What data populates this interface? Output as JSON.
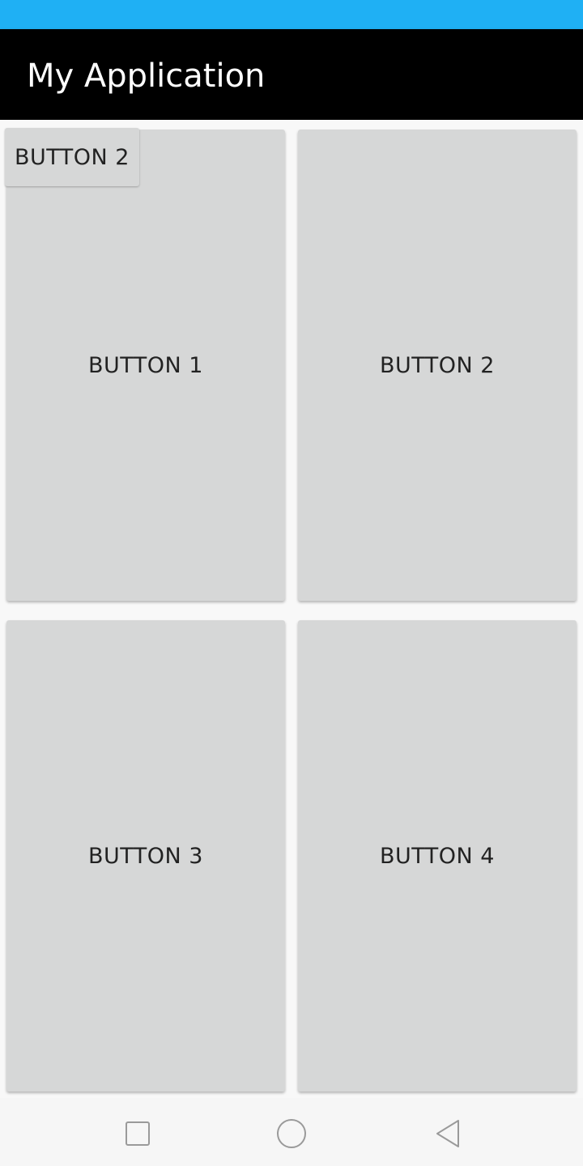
{
  "app_bar": {
    "title": "My Application"
  },
  "colors": {
    "status_bar": "#1fb0f4",
    "app_bar": "#000000",
    "button_bg": "#d6d7d7",
    "button_text": "#222222",
    "content_bg": "#f8f8f8"
  },
  "buttons": [
    {
      "label": "BUTTON 1"
    },
    {
      "label": "BUTTON 2"
    },
    {
      "label": "BUTTON 3"
    },
    {
      "label": "BUTTON 4"
    }
  ],
  "overlay_button": {
    "label": "BUTTON 2"
  },
  "nav_bar": {
    "icons": [
      "square-recents-icon",
      "circle-home-icon",
      "triangle-back-icon"
    ]
  }
}
